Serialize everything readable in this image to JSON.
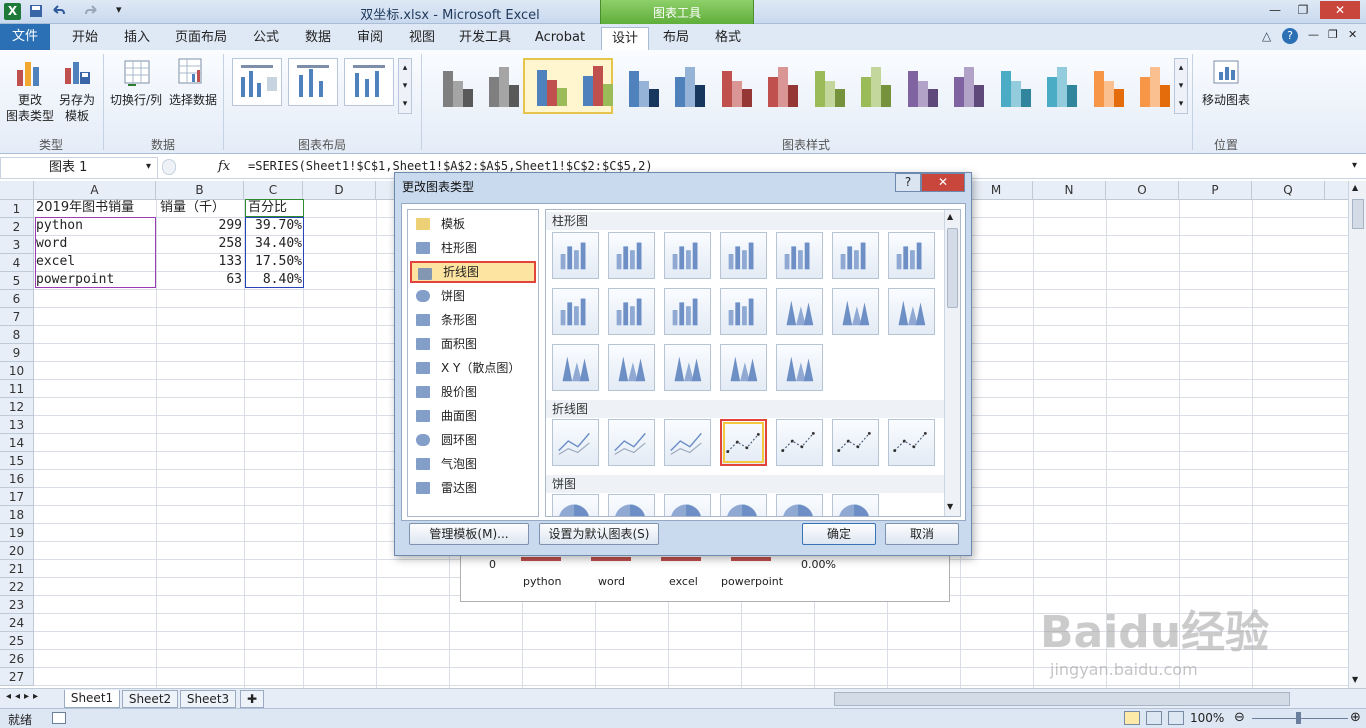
{
  "window": {
    "title": "双坐标.xlsx - Microsoft Excel",
    "context_tab": "图表工具"
  },
  "tabs": {
    "file": "文件",
    "items": [
      "开始",
      "插入",
      "页面布局",
      "公式",
      "数据",
      "审阅",
      "视图",
      "开发工具",
      "Acrobat",
      "设计",
      "布局",
      "格式"
    ],
    "active": "设计"
  },
  "ribbon": {
    "change_type_label_1": "更改",
    "change_type_label_2": "图表类型",
    "save_template_label_1": "另存为",
    "save_template_label_2": "模板",
    "switch_rowcol_label": "切换行/列",
    "select_data_label": "选择数据",
    "move_chart_label": "移动图表",
    "groups": {
      "type": "类型",
      "data": "数据",
      "layout": "图表布局",
      "styles": "图表样式",
      "location": "位置"
    },
    "styles": [
      {
        "colors": [
          "#7f7f7f",
          "#a5a5a5",
          "#595959"
        ]
      },
      {
        "colors": [
          "#4f81bd",
          "#c0504d",
          "#9bbb59"
        ]
      },
      {
        "colors": [
          "#4f81bd",
          "#95b3d7",
          "#17375e"
        ]
      },
      {
        "colors": [
          "#c0504d",
          "#d99694",
          "#953734"
        ]
      },
      {
        "colors": [
          "#9bbb59",
          "#c3d69b",
          "#76923c"
        ]
      },
      {
        "colors": [
          "#8064a2",
          "#b3a2c7",
          "#5f497a"
        ]
      },
      {
        "colors": [
          "#4bacc6",
          "#93cddd",
          "#31859c"
        ]
      },
      {
        "colors": [
          "#f79646",
          "#fac08f",
          "#e46c0a"
        ]
      }
    ]
  },
  "formula_bar": {
    "name_box": "图表 1",
    "fx": "fx",
    "formula": "=SERIES(Sheet1!$C$1,Sheet1!$A$2:$A$5,Sheet1!$C$2:$C$5,2)"
  },
  "columns": [
    "A",
    "B",
    "C",
    "D",
    "E",
    "F",
    "G",
    "H",
    "I",
    "J",
    "K",
    "L",
    "M",
    "N",
    "O",
    "P",
    "Q"
  ],
  "rows": [
    "1",
    "2",
    "3",
    "4",
    "5",
    "6",
    "7",
    "8",
    "9",
    "10",
    "11",
    "12",
    "13",
    "14",
    "15",
    "16",
    "17",
    "18",
    "19",
    "20",
    "21",
    "22",
    "23",
    "24",
    "25",
    "26",
    "27"
  ],
  "sheet": {
    "headers": [
      "2019年图书销量",
      "销量（千）",
      "百分比"
    ],
    "data": [
      [
        "python",
        "299",
        "39.70%"
      ],
      [
        "word",
        "258",
        "34.40%"
      ],
      [
        "excel",
        "133",
        "17.50%"
      ],
      [
        "powerpoint",
        "63",
        "8.40%"
      ]
    ]
  },
  "chart": {
    "axis_zero": "0",
    "axis_pct": "0.00%",
    "categories": [
      "python",
      "word",
      "excel",
      "powerpoint"
    ]
  },
  "dialog": {
    "title": "更改图表类型",
    "help": "?",
    "close": "✕",
    "list": [
      "模板",
      "柱形图",
      "折线图",
      "饼图",
      "条形图",
      "面积图",
      "X Y（散点图）",
      "股价图",
      "曲面图",
      "圆环图",
      "气泡图",
      "雷达图"
    ],
    "selected": "折线图",
    "sections": {
      "column": "柱形图",
      "line": "折线图",
      "pie": "饼图"
    },
    "buttons": {
      "manage": "管理模板(M)...",
      "set_default": "设置为默认图表(S)",
      "ok": "确定",
      "cancel": "取消"
    }
  },
  "sheet_tabs": [
    "Sheet1",
    "Sheet2",
    "Sheet3"
  ],
  "status": {
    "ready": "就绪",
    "zoom": "100%"
  },
  "watermark": {
    "main": "Baidu经验",
    "sub": "jingyan.baidu.com"
  }
}
